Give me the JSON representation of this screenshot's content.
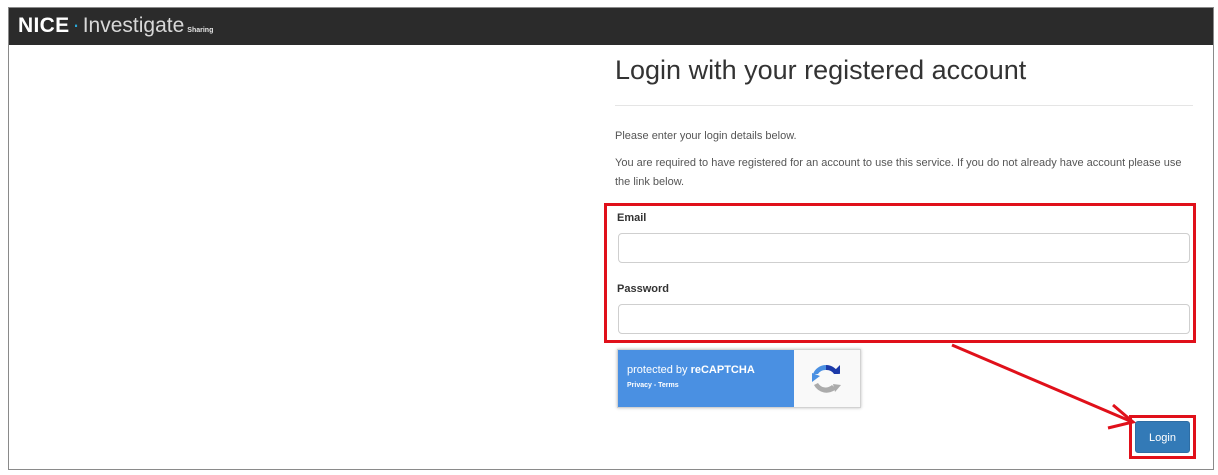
{
  "navbar": {
    "brand_primary": "NICE",
    "brand_separator": "·",
    "brand_secondary": "Investigate",
    "brand_subtitle": "Sharing"
  },
  "login": {
    "title": "Login with your registered account",
    "intro": "Please enter your login details below.",
    "notice": "You are required to have registered for an account to use this service. If you do not already have account please use the link below.",
    "email_label": "Email",
    "email_value": "",
    "password_label": "Password",
    "password_value": "",
    "submit_label": "Login"
  },
  "recaptcha": {
    "protected_prefix": "protected by ",
    "brand": "reCAPTCHA",
    "links": "Privacy - Terms"
  },
  "colors": {
    "navbar_bg": "#2b2b2b",
    "brand_accent": "#2aa7d6",
    "button_primary": "#337ab7",
    "highlight": "#e0101a",
    "recaptcha_blue": "#4a90e2"
  }
}
